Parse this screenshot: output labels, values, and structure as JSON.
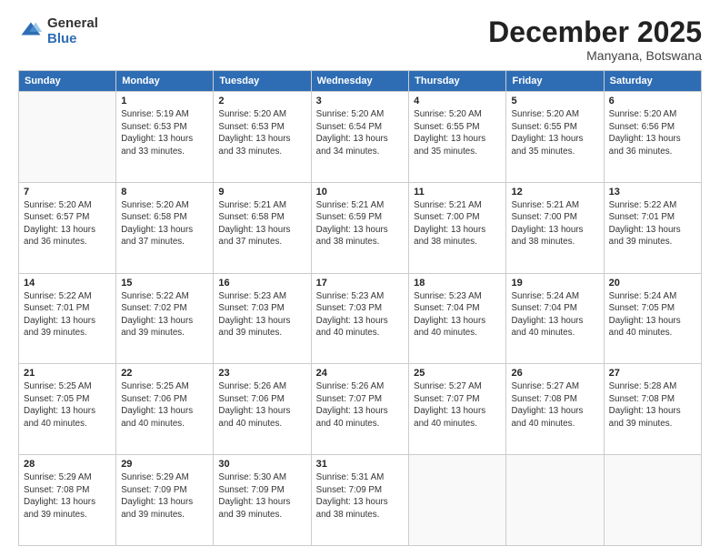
{
  "header": {
    "logo_general": "General",
    "logo_blue": "Blue",
    "month_title": "December 2025",
    "location": "Manyana, Botswana"
  },
  "weekdays": [
    "Sunday",
    "Monday",
    "Tuesday",
    "Wednesday",
    "Thursday",
    "Friday",
    "Saturday"
  ],
  "weeks": [
    [
      {
        "day": "",
        "info": ""
      },
      {
        "day": "1",
        "info": "Sunrise: 5:19 AM\nSunset: 6:53 PM\nDaylight: 13 hours\nand 33 minutes."
      },
      {
        "day": "2",
        "info": "Sunrise: 5:20 AM\nSunset: 6:53 PM\nDaylight: 13 hours\nand 33 minutes."
      },
      {
        "day": "3",
        "info": "Sunrise: 5:20 AM\nSunset: 6:54 PM\nDaylight: 13 hours\nand 34 minutes."
      },
      {
        "day": "4",
        "info": "Sunrise: 5:20 AM\nSunset: 6:55 PM\nDaylight: 13 hours\nand 35 minutes."
      },
      {
        "day": "5",
        "info": "Sunrise: 5:20 AM\nSunset: 6:55 PM\nDaylight: 13 hours\nand 35 minutes."
      },
      {
        "day": "6",
        "info": "Sunrise: 5:20 AM\nSunset: 6:56 PM\nDaylight: 13 hours\nand 36 minutes."
      }
    ],
    [
      {
        "day": "7",
        "info": "Sunrise: 5:20 AM\nSunset: 6:57 PM\nDaylight: 13 hours\nand 36 minutes."
      },
      {
        "day": "8",
        "info": "Sunrise: 5:20 AM\nSunset: 6:58 PM\nDaylight: 13 hours\nand 37 minutes."
      },
      {
        "day": "9",
        "info": "Sunrise: 5:21 AM\nSunset: 6:58 PM\nDaylight: 13 hours\nand 37 minutes."
      },
      {
        "day": "10",
        "info": "Sunrise: 5:21 AM\nSunset: 6:59 PM\nDaylight: 13 hours\nand 38 minutes."
      },
      {
        "day": "11",
        "info": "Sunrise: 5:21 AM\nSunset: 7:00 PM\nDaylight: 13 hours\nand 38 minutes."
      },
      {
        "day": "12",
        "info": "Sunrise: 5:21 AM\nSunset: 7:00 PM\nDaylight: 13 hours\nand 38 minutes."
      },
      {
        "day": "13",
        "info": "Sunrise: 5:22 AM\nSunset: 7:01 PM\nDaylight: 13 hours\nand 39 minutes."
      }
    ],
    [
      {
        "day": "14",
        "info": "Sunrise: 5:22 AM\nSunset: 7:01 PM\nDaylight: 13 hours\nand 39 minutes."
      },
      {
        "day": "15",
        "info": "Sunrise: 5:22 AM\nSunset: 7:02 PM\nDaylight: 13 hours\nand 39 minutes."
      },
      {
        "day": "16",
        "info": "Sunrise: 5:23 AM\nSunset: 7:03 PM\nDaylight: 13 hours\nand 39 minutes."
      },
      {
        "day": "17",
        "info": "Sunrise: 5:23 AM\nSunset: 7:03 PM\nDaylight: 13 hours\nand 40 minutes."
      },
      {
        "day": "18",
        "info": "Sunrise: 5:23 AM\nSunset: 7:04 PM\nDaylight: 13 hours\nand 40 minutes."
      },
      {
        "day": "19",
        "info": "Sunrise: 5:24 AM\nSunset: 7:04 PM\nDaylight: 13 hours\nand 40 minutes."
      },
      {
        "day": "20",
        "info": "Sunrise: 5:24 AM\nSunset: 7:05 PM\nDaylight: 13 hours\nand 40 minutes."
      }
    ],
    [
      {
        "day": "21",
        "info": "Sunrise: 5:25 AM\nSunset: 7:05 PM\nDaylight: 13 hours\nand 40 minutes."
      },
      {
        "day": "22",
        "info": "Sunrise: 5:25 AM\nSunset: 7:06 PM\nDaylight: 13 hours\nand 40 minutes."
      },
      {
        "day": "23",
        "info": "Sunrise: 5:26 AM\nSunset: 7:06 PM\nDaylight: 13 hours\nand 40 minutes."
      },
      {
        "day": "24",
        "info": "Sunrise: 5:26 AM\nSunset: 7:07 PM\nDaylight: 13 hours\nand 40 minutes."
      },
      {
        "day": "25",
        "info": "Sunrise: 5:27 AM\nSunset: 7:07 PM\nDaylight: 13 hours\nand 40 minutes."
      },
      {
        "day": "26",
        "info": "Sunrise: 5:27 AM\nSunset: 7:08 PM\nDaylight: 13 hours\nand 40 minutes."
      },
      {
        "day": "27",
        "info": "Sunrise: 5:28 AM\nSunset: 7:08 PM\nDaylight: 13 hours\nand 39 minutes."
      }
    ],
    [
      {
        "day": "28",
        "info": "Sunrise: 5:29 AM\nSunset: 7:08 PM\nDaylight: 13 hours\nand 39 minutes."
      },
      {
        "day": "29",
        "info": "Sunrise: 5:29 AM\nSunset: 7:09 PM\nDaylight: 13 hours\nand 39 minutes."
      },
      {
        "day": "30",
        "info": "Sunrise: 5:30 AM\nSunset: 7:09 PM\nDaylight: 13 hours\nand 39 minutes."
      },
      {
        "day": "31",
        "info": "Sunrise: 5:31 AM\nSunset: 7:09 PM\nDaylight: 13 hours\nand 38 minutes."
      },
      {
        "day": "",
        "info": ""
      },
      {
        "day": "",
        "info": ""
      },
      {
        "day": "",
        "info": ""
      }
    ]
  ]
}
